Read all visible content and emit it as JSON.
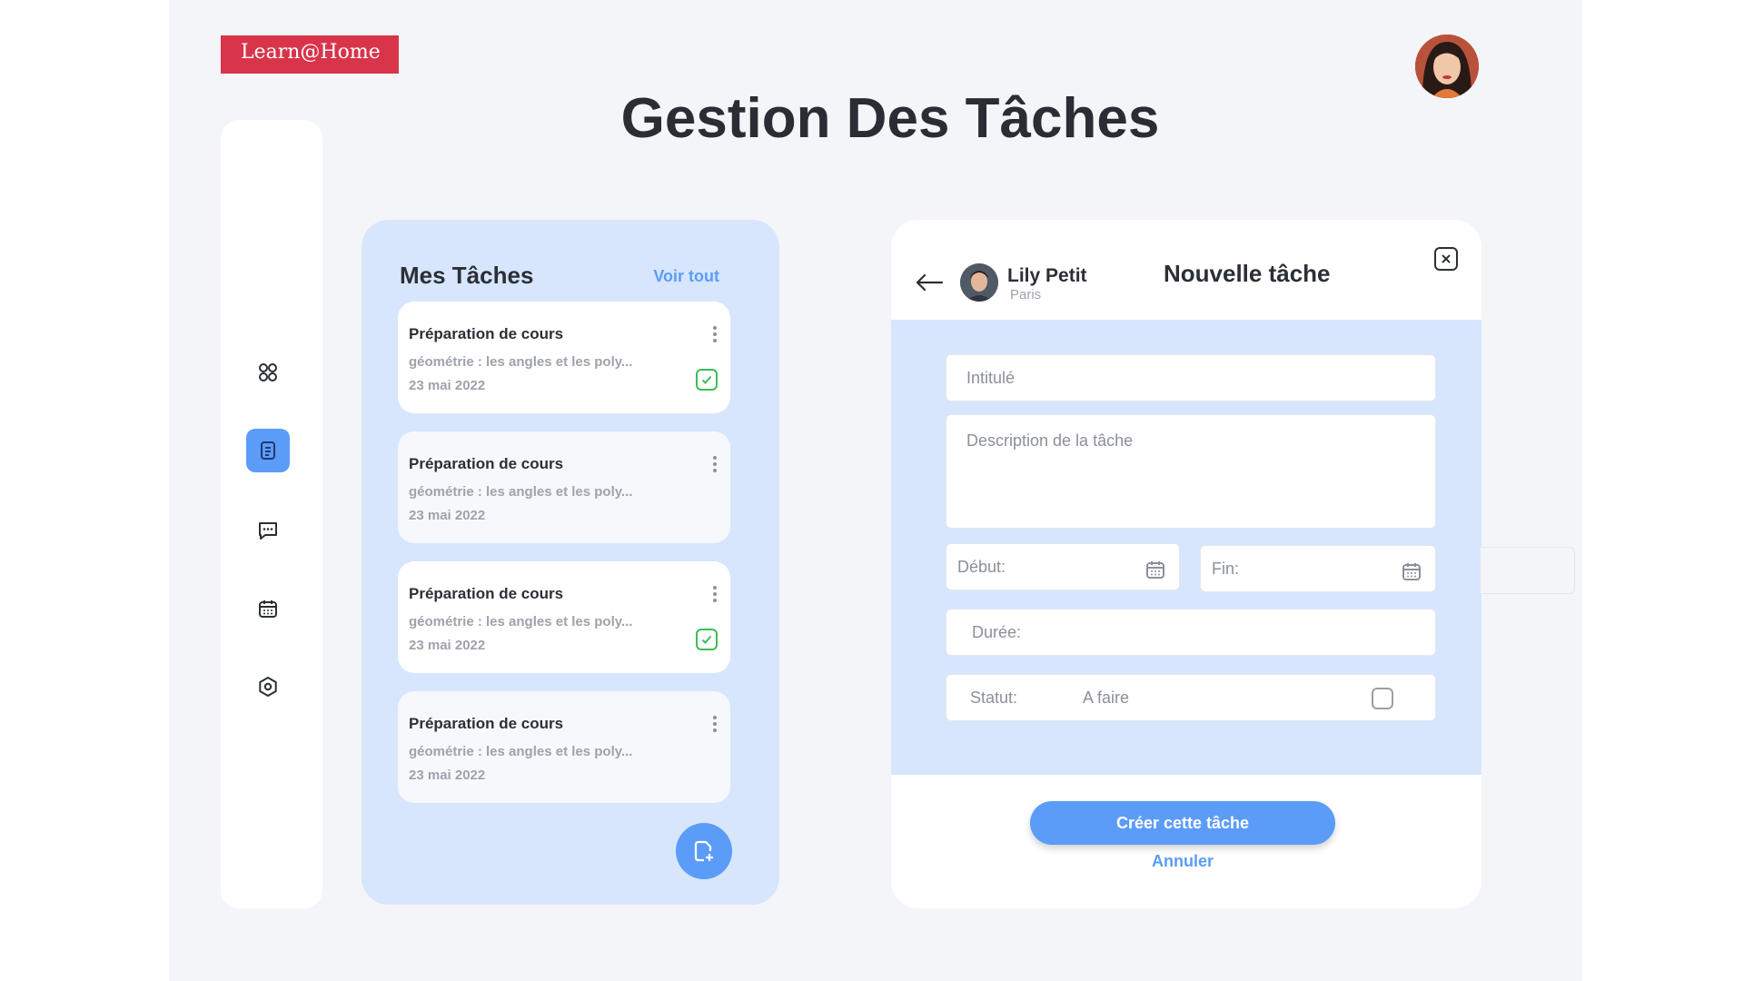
{
  "app": {
    "brand": "Learn@Home",
    "page_title": "Gestion Des Tâches"
  },
  "sidebar": {
    "items": [
      {
        "icon": "grid-icon",
        "active": false
      },
      {
        "icon": "document-icon",
        "active": true
      },
      {
        "icon": "chat-icon",
        "active": false
      },
      {
        "icon": "calendar-icon",
        "active": false
      },
      {
        "icon": "settings-icon",
        "active": false
      }
    ]
  },
  "tasks": {
    "title": "Mes Tâches",
    "see_all": "Voir tout",
    "items": [
      {
        "name": "Préparation de cours",
        "desc": "géométrie : les angles et  les poly...",
        "date": "23 mai 2022",
        "checked": true
      },
      {
        "name": "Préparation de cours",
        "desc": "géométrie : les angles et  les poly...",
        "date": "23 mai 2022",
        "checked": false
      },
      {
        "name": "Préparation de cours",
        "desc": "géométrie : les angles et  les poly...",
        "date": "23 mai 2022",
        "checked": true
      },
      {
        "name": "Préparation de cours",
        "desc": "géométrie : les angles et  les poly...",
        "date": "23 mai 2022",
        "checked": false
      }
    ]
  },
  "form": {
    "user_name": "Lily Petit",
    "user_city": "Paris",
    "title": "Nouvelle tâche",
    "title_placeholder": "Intitulé",
    "description_placeholder": "Description de la tâche",
    "start_label": "Début:",
    "end_label": "Fin:",
    "duration_label": "Durée:",
    "status_label": "Statut:",
    "status_value": "A faire",
    "create_label": "Créer cette tâche",
    "cancel_label": "Annuler"
  },
  "colors": {
    "brand": "#d8344a",
    "accent": "#5b9cf9",
    "panel": "#d7e6fd",
    "check": "#3bbf55"
  }
}
